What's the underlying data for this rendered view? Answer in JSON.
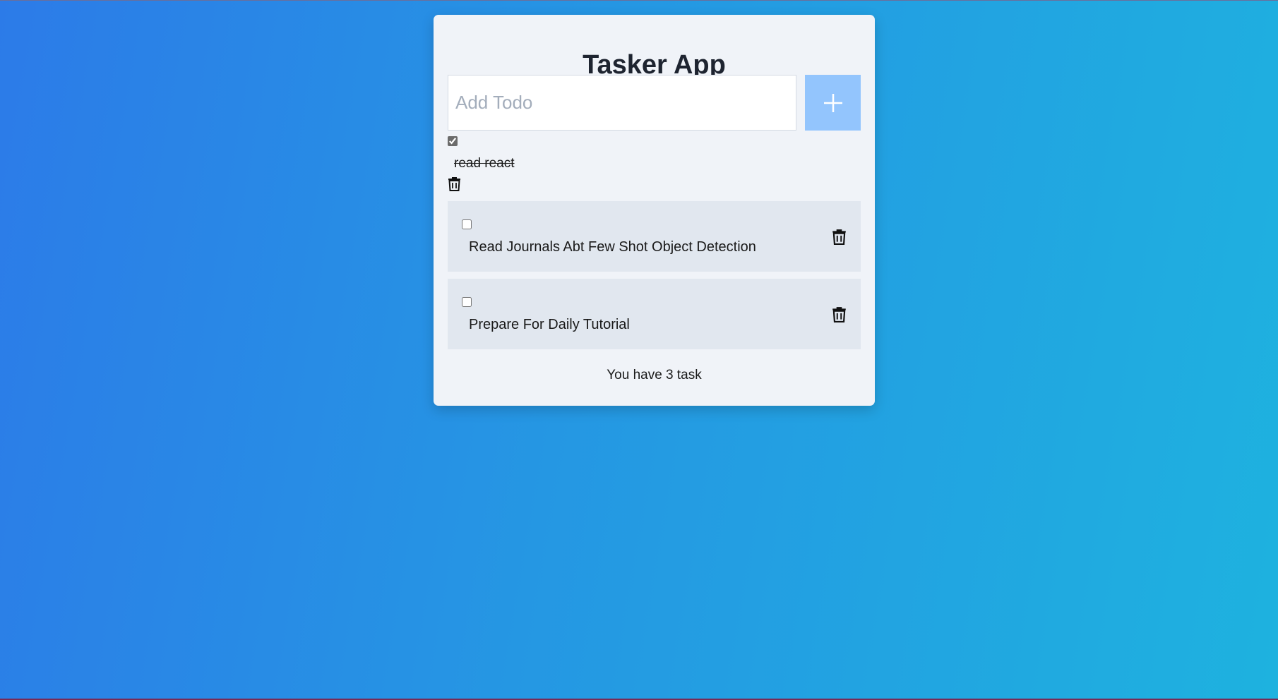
{
  "app": {
    "title": "Tasker App"
  },
  "new_todo": {
    "placeholder": "Add Todo",
    "value": "",
    "add_icon": "plus-icon"
  },
  "completed_tasks": [
    {
      "label": "read react",
      "done": true
    }
  ],
  "tasks": [
    {
      "label": "Read Journals Abt Few Shot Object Detection",
      "done": false
    },
    {
      "label": "Prepare For Daily Tutorial",
      "done": false
    }
  ],
  "footer": {
    "task_count_text": "You have 3 task"
  },
  "colors": {
    "background_start": "#2c7be8",
    "background_end": "#1eb2df",
    "card": "#f0f3f8",
    "task_row": "#e1e7ef",
    "add_button": "#93c5fd"
  },
  "icons": {
    "delete": "trash-icon"
  }
}
